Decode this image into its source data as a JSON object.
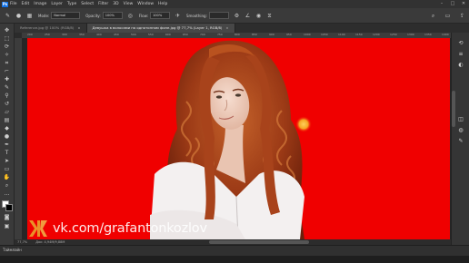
{
  "menubar": {
    "logo": "Ps",
    "items": [
      "File",
      "Edit",
      "Image",
      "Layer",
      "Type",
      "Select",
      "Filter",
      "3D",
      "View",
      "Window",
      "Help"
    ],
    "window_controls": [
      "–",
      "□",
      "✕"
    ]
  },
  "options": {
    "mode_label": "Mode:",
    "mode_value": "Normal",
    "opacity_label": "Opacity:",
    "opacity_value": "100%",
    "flow_label": "Flow:",
    "flow_value": "100%",
    "smoothing_label": "Smoothing:"
  },
  "tabs": [
    {
      "label": "Reference.jpg @ 100% (RGB/8)"
    },
    {
      "label": "Девушка в волосами на однотонном фоне.jpg @ 77,7% (Layer 1, RGB/8)"
    }
  ],
  "ruler_ticks": [
    "200",
    "250",
    "300",
    "350",
    "400",
    "450",
    "500",
    "550",
    "600",
    "650",
    "700",
    "750",
    "800",
    "850",
    "900",
    "950",
    "1000",
    "1050",
    "1100",
    "1150",
    "1200",
    "1250",
    "1300",
    "1350",
    "1400"
  ],
  "status": {
    "zoom": "77,7%",
    "doc": "Док: 4,94M/9,88M"
  },
  "timeline": {
    "label": "Таймлайн"
  },
  "watermark": {
    "text": "vk.com/grafantonkozlov"
  },
  "colors": {
    "canvas": "#f00000",
    "accent": "#1473e6",
    "brush_cursor": "#f5a623",
    "panel": "#3a3a3a"
  }
}
